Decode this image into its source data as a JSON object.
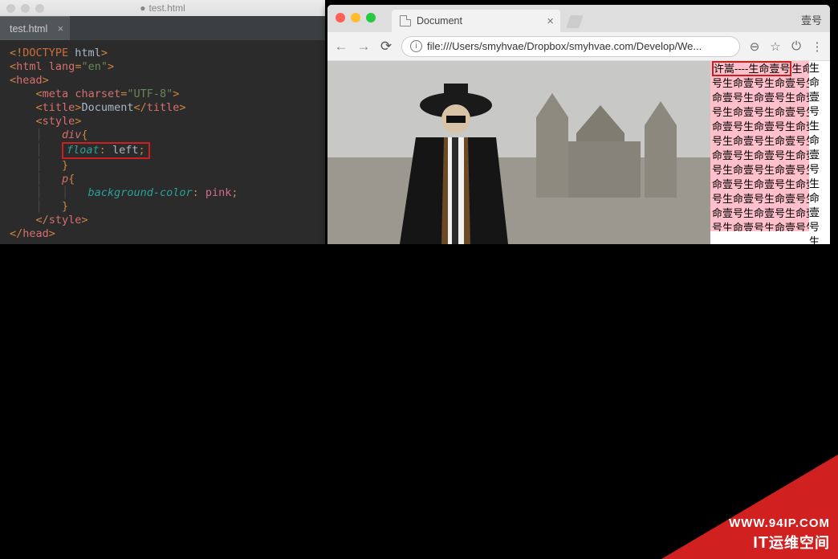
{
  "mac_titlebar": {
    "filename": "test.html"
  },
  "editor": {
    "tab": {
      "name": "test.html"
    },
    "code": {
      "line1": {
        "p": "<!",
        "d": "DOCTYPE",
        "h": " html",
        "e": ">"
      },
      "line2": {
        "o": "<",
        "t": "html",
        "sp": " ",
        "a": "lang",
        "eq": "=",
        "v": "\"en\"",
        "c": ">"
      },
      "line3": {
        "o": "<",
        "t": "head",
        "c": ">"
      },
      "line4": {
        "o": "<",
        "t": "meta",
        "sp": " ",
        "a": "charset",
        "eq": "=",
        "v": "\"UTF-8\"",
        "c": ">"
      },
      "line5": {
        "o": "<",
        "t": "title",
        "c": ">",
        "txt": "Document",
        "o2": "</",
        "t2": "title",
        "c2": ">"
      },
      "line6": {
        "o": "<",
        "t": "style",
        "c": ">"
      },
      "line7": {
        "sel": "div",
        "b": "{"
      },
      "line8": {
        "p": "float",
        "col": ":",
        "val": " left",
        "sc": ";"
      },
      "line9": {
        "b": "}"
      },
      "line10": {
        "sel": "p",
        "b": "{"
      },
      "line11": {
        "p": "background-color",
        "col": ":",
        "val": " pink",
        "sc": ";"
      },
      "line12": {
        "b": "}"
      },
      "line13": {
        "o": "</",
        "t": "style",
        "c": ">"
      },
      "line14": {
        "o": "</",
        "t": "head",
        "c": ">"
      }
    }
  },
  "chrome": {
    "tab_title": "Document",
    "corner_label": "壹号",
    "url": "file:///Users/smyhvae/Dropbox/smyhvae.com/Develop/We...",
    "pink_first": "许嵩----生命壹号",
    "pink_repeat": "生命壹号生命壹号生命壹号生命壹号生命壹号生命壹号生命壹号生命壹号生命壹号生命壹号生命壹号生命壹号生命壹号生命壹号生命壹号生命壹号生命壹号生命壹号生命壹号生命壹号生命壹号生命壹号生命壹号生命壹号生命壹号生命壹号生命壹号生命壹号生命壹号生命壹号生命壹号生命壹号生命壹号生命壹号生命壹号生命壹号生命壹号生命壹号生命壹号",
    "overflow_col": "生命壹号生命壹号生命壹号生命壹号生命壹号生命壹号生命壹"
  },
  "watermark": {
    "line1": "WWW.94IP.COM",
    "line2_en": "IT",
    "line2_zh": "运维空间"
  }
}
